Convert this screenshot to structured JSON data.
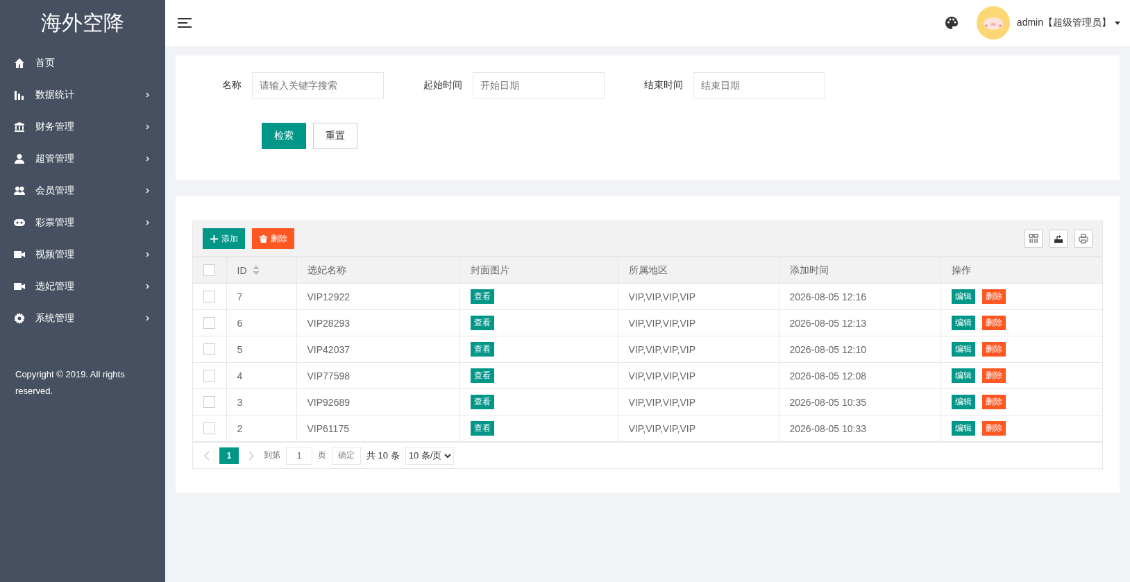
{
  "sidebar": {
    "title": "海外空降",
    "items": [
      {
        "label": "首页",
        "kind": "home",
        "arrow": false
      },
      {
        "label": "数据统计",
        "kind": "chart",
        "arrow": true
      },
      {
        "label": "财务管理",
        "kind": "bank",
        "arrow": true
      },
      {
        "label": "超管管理",
        "kind": "user",
        "arrow": true
      },
      {
        "label": "会员管理",
        "kind": "users",
        "arrow": true
      },
      {
        "label": "彩票管理",
        "kind": "gamepad",
        "arrow": true
      },
      {
        "label": "视频管理",
        "kind": "video",
        "arrow": true
      },
      {
        "label": "选妃管理",
        "kind": "video",
        "arrow": true
      },
      {
        "label": "系统管理",
        "kind": "gear",
        "arrow": true
      }
    ],
    "copyright": "Copyright © 2019. All rights reserved."
  },
  "header": {
    "user": "admin【超级管理员】"
  },
  "search": {
    "fields": [
      {
        "label": "名称",
        "placeholder": "请输入关键字搜索"
      },
      {
        "label": "起始时间",
        "placeholder": "开始日期"
      },
      {
        "label": "结束时间",
        "placeholder": "结束日期"
      }
    ],
    "buttons": [
      {
        "label": "检索",
        "kind": "primary"
      },
      {
        "label": "重置",
        "kind": "plain"
      }
    ]
  },
  "table": {
    "toolbar": [
      {
        "label": "添加",
        "kind": "add"
      },
      {
        "label": "删除",
        "kind": "delete"
      }
    ],
    "header_checked": false,
    "columns": [
      {
        "label": "ID",
        "sortable": true
      },
      {
        "label": "选妃名称",
        "sortable": false
      },
      {
        "label": "封面图片",
        "sortable": false
      },
      {
        "label": "所属地区",
        "sortable": false
      },
      {
        "label": "添加时间",
        "sortable": false
      },
      {
        "label": "操作",
        "sortable": false
      }
    ],
    "rows": [
      {
        "checked": false,
        "id": "7",
        "name": "VIP12922",
        "cover": "查看",
        "region": "VIP,VIP,VIP,VIP",
        "time": "2026-08-05 12:16",
        "actions": [
          {
            "label": "编辑",
            "kind": "edit"
          },
          {
            "label": "删除",
            "kind": "delete"
          }
        ]
      },
      {
        "checked": false,
        "id": "6",
        "name": "VIP28293",
        "cover": "查看",
        "region": "VIP,VIP,VIP,VIP",
        "time": "2026-08-05 12:13",
        "actions": [
          {
            "label": "编辑",
            "kind": "edit"
          },
          {
            "label": "删除",
            "kind": "delete"
          }
        ]
      },
      {
        "checked": false,
        "id": "5",
        "name": "VIP42037",
        "cover": "查看",
        "region": "VIP,VIP,VIP,VIP",
        "time": "2026-08-05 12:10",
        "actions": [
          {
            "label": "编辑",
            "kind": "edit"
          },
          {
            "label": "删除",
            "kind": "delete"
          }
        ]
      },
      {
        "checked": false,
        "id": "4",
        "name": "VIP77598",
        "cover": "查看",
        "region": "VIP,VIP,VIP,VIP",
        "time": "2026-08-05 12:08",
        "actions": [
          {
            "label": "编辑",
            "kind": "edit"
          },
          {
            "label": "删除",
            "kind": "delete"
          }
        ]
      },
      {
        "checked": false,
        "id": "3",
        "name": "VIP92689",
        "cover": "查看",
        "region": "VIP,VIP,VIP,VIP",
        "time": "2026-08-05 10:35",
        "actions": [
          {
            "label": "编辑",
            "kind": "edit"
          },
          {
            "label": "删除",
            "kind": "delete"
          }
        ]
      },
      {
        "checked": false,
        "id": "2",
        "name": "VIP61175",
        "cover": "查看",
        "region": "VIP,VIP,VIP,VIP",
        "time": "2026-08-05 10:33",
        "actions": [
          {
            "label": "编辑",
            "kind": "edit"
          },
          {
            "label": "删除",
            "kind": "delete"
          }
        ]
      }
    ]
  },
  "pagination": {
    "pages": [
      {
        "label": "1",
        "selected": true
      }
    ],
    "goto_label": "到第",
    "goto_value": "1",
    "page_unit": "页",
    "confirm": "确定",
    "total": "共 10 条",
    "page_size": "10 条/页"
  }
}
